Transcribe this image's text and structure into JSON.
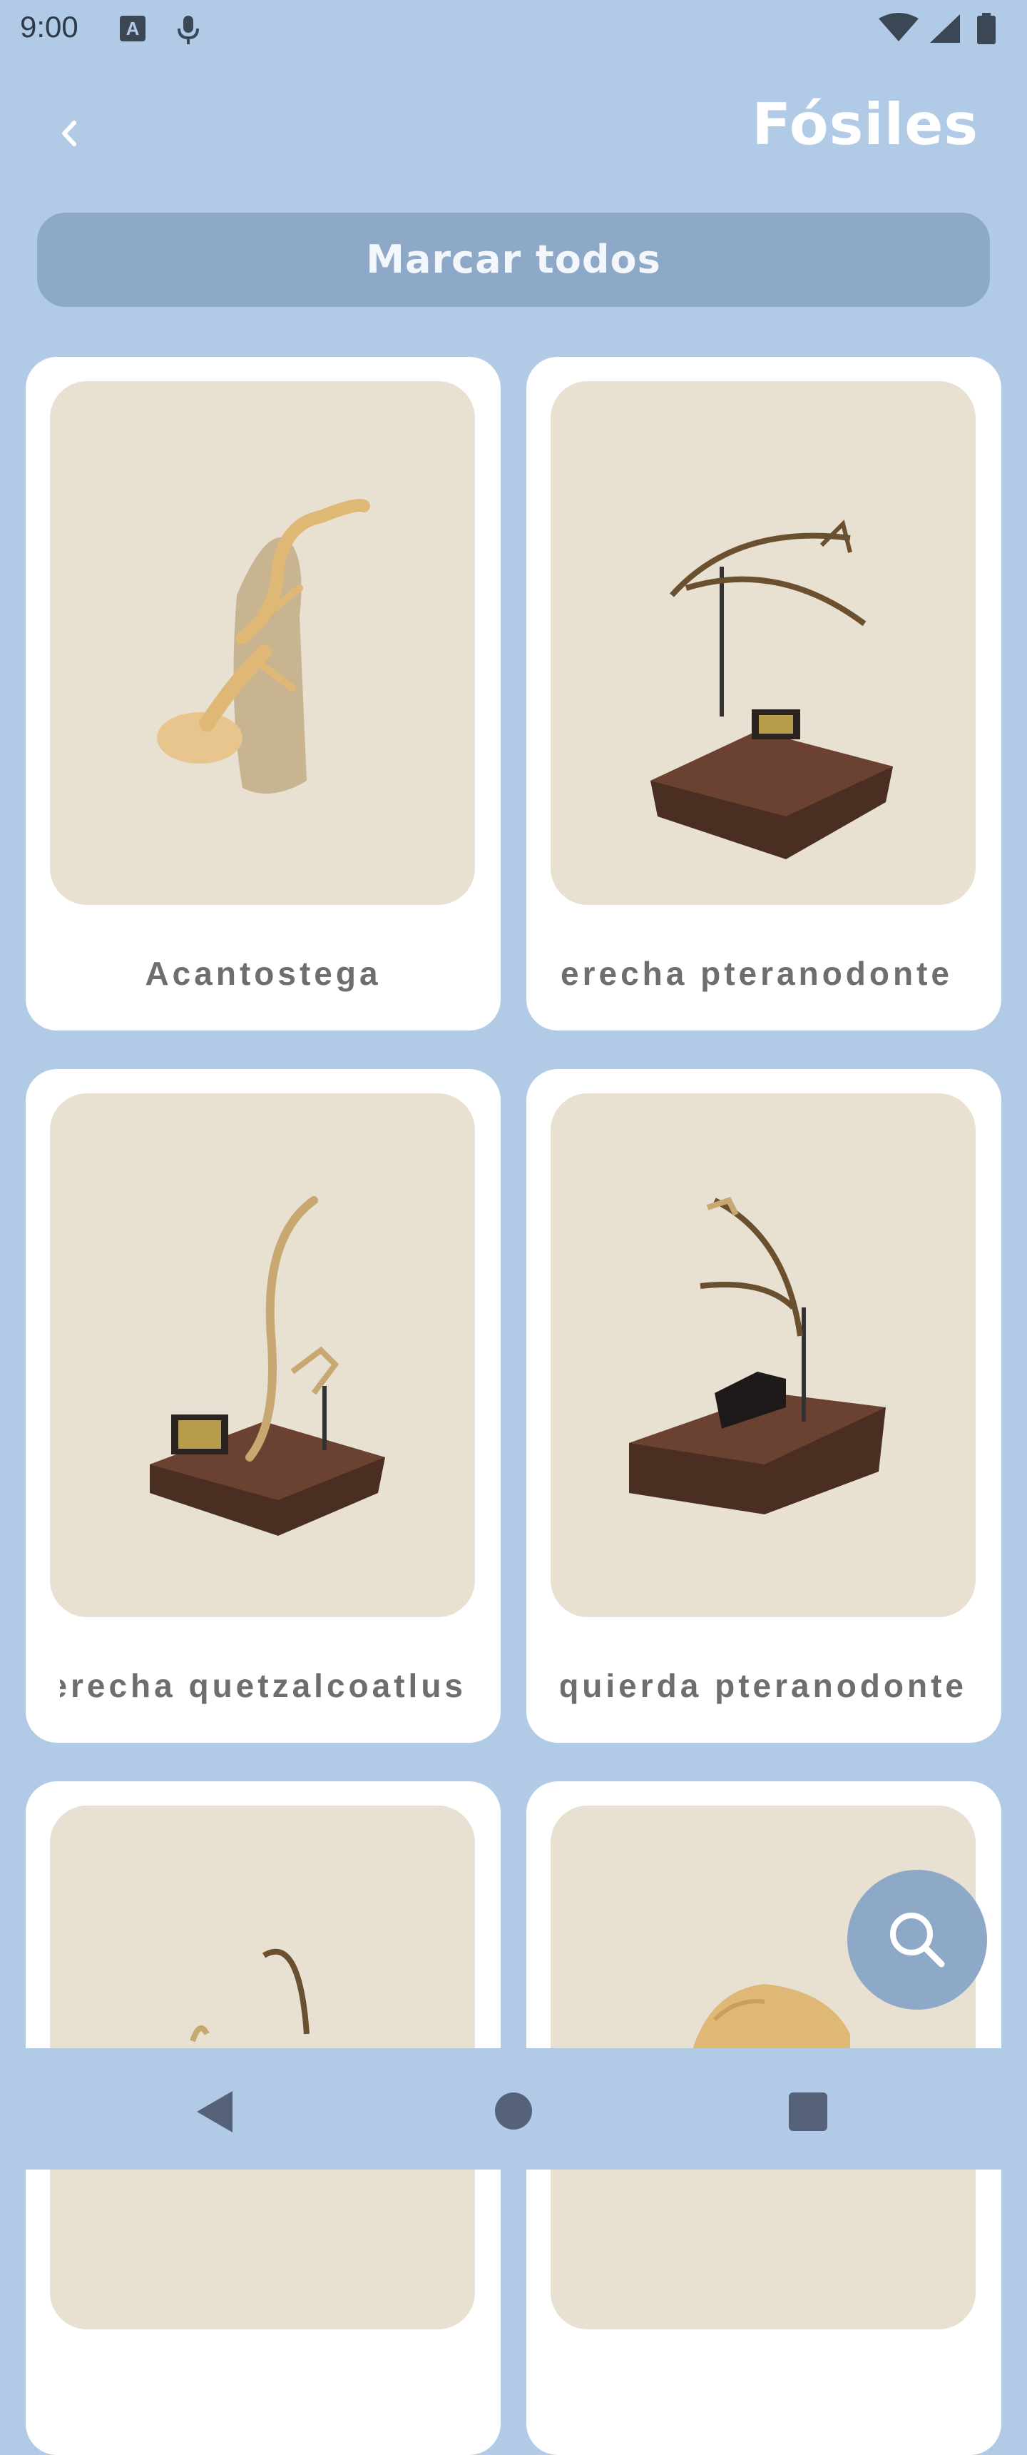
{
  "status": {
    "time": "9:00",
    "keyboard_badge": "A"
  },
  "header": {
    "title": "Fósiles",
    "back_icon": "chevron-left-icon"
  },
  "actions": {
    "mark_all_label": "Marcar todos"
  },
  "fossils": [
    {
      "name": "Acantostega"
    },
    {
      "name": "erecha pteranodonte"
    },
    {
      "name": "erecha quetzalcoatlus"
    },
    {
      "name": "zquierda pteranodonte"
    },
    {
      "name": ""
    },
    {
      "name": ""
    }
  ],
  "fab": {
    "icon": "search-icon"
  },
  "nav": {
    "back_icon": "triangle-back-icon",
    "home_icon": "circle-home-icon",
    "recents_icon": "square-recents-icon"
  },
  "colors": {
    "background": "#b1cae6",
    "accent": "#8ea9c8",
    "card": "#ffffff",
    "thumb": "#e8e0d1"
  }
}
